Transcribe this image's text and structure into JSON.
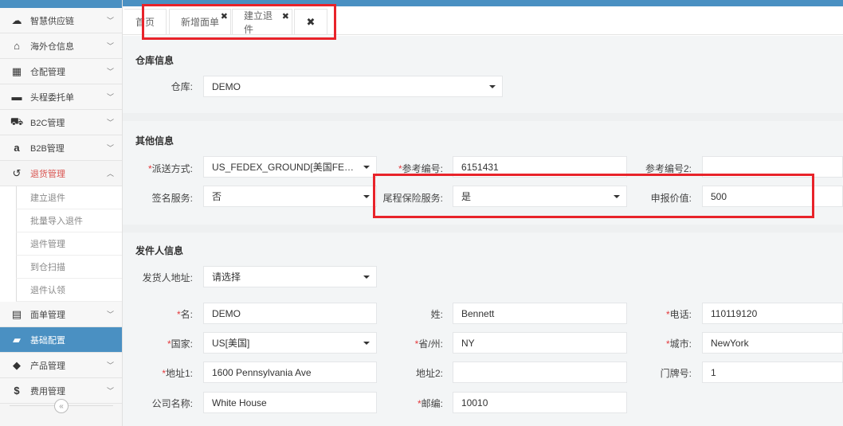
{
  "sidebar": {
    "items": [
      {
        "label": "智慧供应链",
        "icon": "cloud-icon",
        "glyph": "☁"
      },
      {
        "label": "海外仓信息",
        "icon": "home-icon",
        "glyph": "⌂"
      },
      {
        "label": "仓配管理",
        "icon": "grid-icon",
        "glyph": "▦"
      },
      {
        "label": "头程委托单",
        "icon": "briefcase-icon",
        "glyph": "▬"
      },
      {
        "label": "B2C管理",
        "icon": "cart-icon",
        "glyph": "⛟"
      },
      {
        "label": "B2B管理",
        "icon": "amazon-icon",
        "glyph": "a"
      },
      {
        "label": "退货管理",
        "icon": "undo-icon",
        "glyph": "↺"
      }
    ],
    "returns_submenu": [
      "建立退件",
      "批量导入退件",
      "退件管理",
      "到仓扫描",
      "退件认领"
    ],
    "bottom_items": [
      {
        "label": "面单管理",
        "icon": "file-icon",
        "glyph": "▤"
      },
      {
        "label": "基础配置",
        "icon": "folder-icon",
        "glyph": "▰"
      },
      {
        "label": "产品管理",
        "icon": "tag-icon",
        "glyph": "◆"
      },
      {
        "label": "费用管理",
        "icon": "dollar-icon",
        "glyph": "$"
      }
    ],
    "collapse_glyph": "«"
  },
  "tabs": {
    "home": "首页",
    "new_waybill": "新增面单",
    "create_return": "建立退件",
    "close_glyph": "✖"
  },
  "warehouse": {
    "title": "仓库信息",
    "label": "仓库:",
    "value": "DEMO"
  },
  "other": {
    "title": "其他信息",
    "shipping_method_label": "派送方式:",
    "shipping_method_value": "US_FEDEX_GROUND[美国FEDEX_...",
    "ref_no_label": "参考编号:",
    "ref_no_value": "6151431",
    "ref_no2_label": "参考编号2:",
    "ref_no2_value": "",
    "signature_label": "签名服务:",
    "signature_value": "否",
    "insurance_label": "尾程保险服务:",
    "insurance_value": "是",
    "declared_label": "申报价值:",
    "declared_value": "500"
  },
  "sender": {
    "title": "发件人信息",
    "address_label": "发货人地址:",
    "address_value": "请选择",
    "name_label": "名:",
    "name_value": "DEMO",
    "surname_label": "姓:",
    "surname_value": "Bennett",
    "phone_label": "电话:",
    "phone_value": "110119120",
    "country_label": "国家:",
    "country_value": "US[美国]",
    "state_label": "省/州:",
    "state_value": "NY",
    "city_label": "城市:",
    "city_value": "NewYork",
    "address1_label": "地址1:",
    "address1_value": "1600 Pennsylvania Ave",
    "address2_label": "地址2:",
    "address2_value": "",
    "door_label": "门牌号:",
    "door_value": "1",
    "company_label": "公司名称:",
    "company_value": "White House",
    "zip_label": "邮编:",
    "zip_value": "10010"
  },
  "required_mark": "*",
  "colors": {
    "accent": "#4a90c2",
    "highlight": "#e8232a",
    "required": "#e4393c"
  }
}
